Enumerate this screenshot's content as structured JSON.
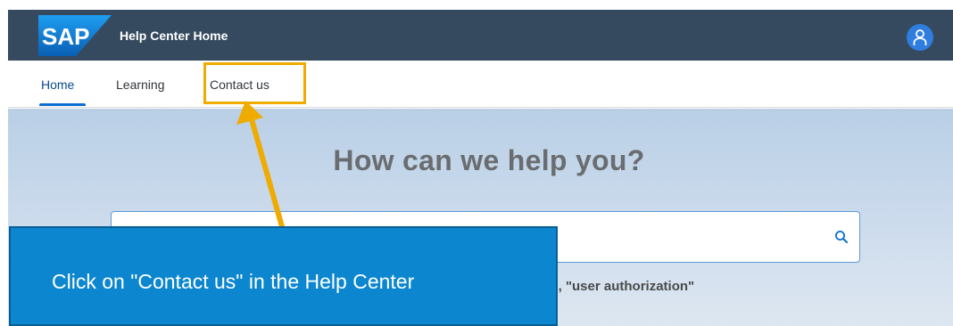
{
  "shell": {
    "logo_text": "SAP",
    "title": "Help Center Home"
  },
  "tabs": [
    {
      "label": "Home",
      "active": true
    },
    {
      "label": "Learning",
      "active": false
    },
    {
      "label": "Contact us",
      "active": false
    }
  ],
  "hero": {
    "heading": "How can we help you?",
    "search_value": "",
    "suggestions_visible": "', \"user authorization\""
  },
  "callout": {
    "text": "Click on \"Contact us\" in the Help Center"
  },
  "icons": {
    "avatar": "user-icon",
    "search": "search-icon",
    "logo": "sap-logo"
  },
  "colors": {
    "shellbar": "#354a5f",
    "highlight": "#f0ab00",
    "callout": "#0b86cf",
    "avatar": "#2f7dde",
    "active_tab": "#0a6ed1"
  }
}
